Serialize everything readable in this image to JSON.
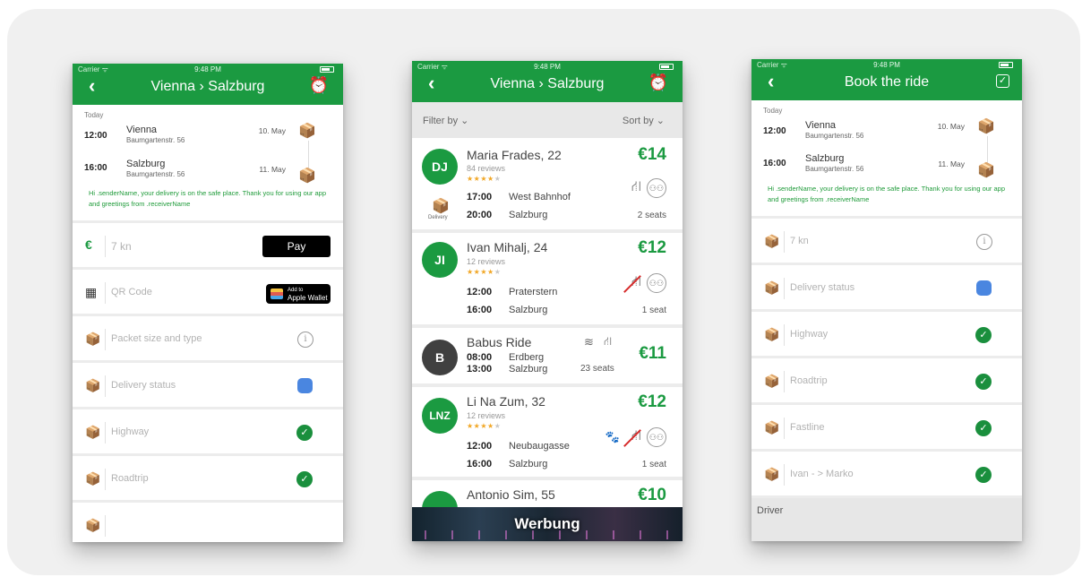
{
  "status": {
    "carrier": "Carrier ᯤ",
    "time": "9:48 PM"
  },
  "phone1": {
    "title": "Vienna › Salzburg",
    "trip": {
      "today": "Today",
      "departure": {
        "time": "12:00",
        "city": "Vienna",
        "address": "Baumgartenstr. 56",
        "date": "10. May"
      },
      "arrival": {
        "time": "16:00",
        "city": "Salzburg",
        "address": "Baumgartenstr. 56",
        "date": "11. May"
      },
      "message": "Hi .senderName, your delivery is on the safe place. Thank you for using our app and greetings from .receiverName"
    },
    "payment": {
      "currency_symbol": "€",
      "amount": "7 kn",
      "apple_pay_label": "Pay"
    },
    "qr": {
      "label": "QR Code",
      "wallet_small": "Add to",
      "wallet_big": "Apple Wallet"
    },
    "rows": [
      {
        "label": "Packet size and type",
        "status": "info"
      },
      {
        "label": "Delivery status",
        "status": "blue"
      },
      {
        "label": "Highway",
        "status": "check"
      },
      {
        "label": "Roadtrip",
        "status": "check"
      }
    ]
  },
  "phone2": {
    "title": "Vienna › Salzburg",
    "filter_label": "Filter by ⌄",
    "sort_label": "Sort by ⌄",
    "rides": [
      {
        "initials": "DJ",
        "name": "Maria Frades, 22",
        "reviews": "84 reviews",
        "stars": 4,
        "price": "€14",
        "dep_time": "17:00",
        "dep_place": "West Bahnhof",
        "arr_time": "20:00",
        "arr_place": "Salzburg",
        "seats": "2 seats",
        "delivery_label": "Delivery"
      },
      {
        "initials": "JI",
        "name": "Ivan Mihalj, 24",
        "reviews": "12 reviews",
        "stars": 4,
        "price": "€12",
        "dep_time": "12:00",
        "dep_place": "Praterstern",
        "arr_time": "16:00",
        "arr_place": "Salzburg",
        "seats": "1 seat"
      },
      {
        "initials": "B",
        "name": "Babus Ride",
        "price": "€11",
        "dep_time": "08:00",
        "dep_place": "Erdberg",
        "arr_time": "13:00",
        "arr_place": "Salzburg",
        "seats": "23 seats"
      },
      {
        "initials": "LNZ",
        "name": "Li Na Zum, 32",
        "reviews": "12 reviews",
        "stars": 4,
        "price": "€12",
        "dep_time": "12:00",
        "dep_place": "Neubaugasse",
        "arr_time": "16:00",
        "arr_place": "Salzburg",
        "seats": "1 seat"
      },
      {
        "name": "Antonio Sim, 55",
        "price": "€10"
      }
    ],
    "ad_text": "Werbung"
  },
  "phone3": {
    "title": "Book the ride",
    "trip": {
      "today": "Today",
      "departure": {
        "time": "12:00",
        "city": "Vienna",
        "address": "Baumgartenstr. 56",
        "date": "10. May"
      },
      "arrival": {
        "time": "16:00",
        "city": "Salzburg",
        "address": "Baumgartenstr. 56",
        "date": "11. May"
      },
      "message": "Hi .senderName, your delivery is on the safe place. Thank you for using our app and greetings from .receiverName"
    },
    "rows": [
      {
        "label": "7 kn",
        "status": "info"
      },
      {
        "label": "Delivery status",
        "status": "blue"
      },
      {
        "label": "Highway",
        "status": "check"
      },
      {
        "label": "Roadtrip",
        "status": "check"
      },
      {
        "label": "Fastline",
        "status": "check"
      },
      {
        "label": "Ivan - > Marko",
        "status": "check"
      }
    ],
    "driver_label": "Driver"
  },
  "colors": {
    "brand_green": "#1b9a41",
    "status_blue": "#4a86e0",
    "package_orange": "#f1a726"
  }
}
